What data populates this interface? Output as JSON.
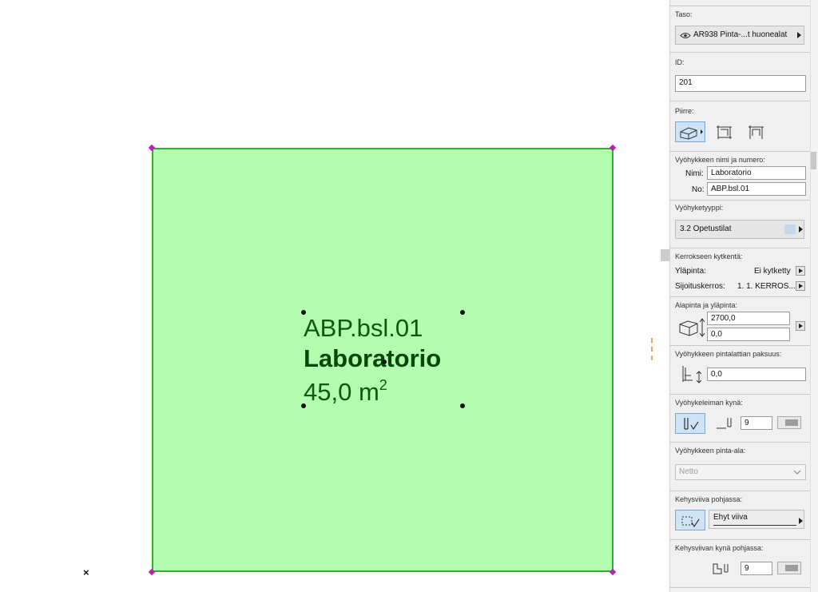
{
  "canvas": {
    "zone_stamp": {
      "number": "ABP.bsl.01",
      "name": "Laboratorio",
      "area": "45,0 m",
      "area_unit_sup": "2"
    },
    "origin_marker": "×",
    "zone_fill": "#b3fcb0",
    "zone_border": "#2fb32f"
  },
  "panel": {
    "layer": {
      "label": "Taso:",
      "value": "AR938 Pinta-...t huonealat"
    },
    "id": {
      "label": "ID:",
      "value": "201"
    },
    "feature": {
      "label": "Piirre:"
    },
    "zone_name_number": {
      "label": "Vyöhykkeen nimi ja numero:",
      "name_label": "Nimi:",
      "name_value": "Laboratorio",
      "no_label": "No:",
      "no_value": "ABP.bsl.01"
    },
    "zone_type": {
      "label": "Vyöhyketyyppi:",
      "value": "3.2  Opetustilat",
      "swatch": "#c5d8e6"
    },
    "story_link": {
      "label": "Kerrokseen kytkentä:",
      "top_label": "Yläpinta:",
      "top_value": "Ei kytketty",
      "home_label": "Sijoituskerros:",
      "home_value": "1. 1. KERROS..."
    },
    "bottom_top": {
      "label": "Alapinta ja yläpinta:",
      "height": "2700,0",
      "offset": "0,0"
    },
    "floor_thickness": {
      "label": "Vyöhykkeen pintalattian paksuus:",
      "value": "0,0"
    },
    "stamp_pen": {
      "label": "Vyöhykeleiman kynä:",
      "pen": "9"
    },
    "zone_area": {
      "label": "Vyöhykkeen pinta-ala:",
      "value": "Netto"
    },
    "contour_line": {
      "label": "Kehysviiva pohjassa:",
      "value": "Ehyt viiva"
    },
    "contour_pen": {
      "label": "Kehysviivan kynä pohjassa:",
      "pen": "9"
    }
  }
}
